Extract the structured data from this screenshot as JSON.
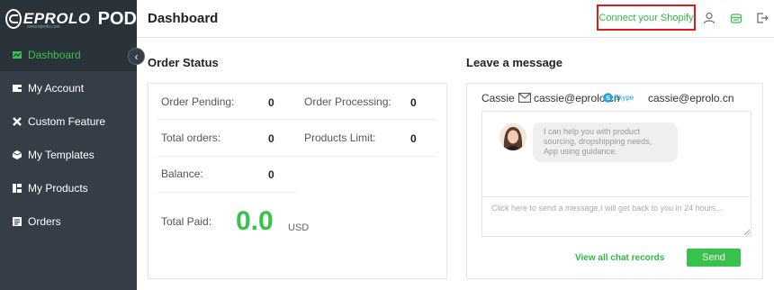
{
  "brand": {
    "name": "EPROLO",
    "product": "POD",
    "tagline": "www.eprolo.com"
  },
  "sidebar": {
    "items": [
      {
        "label": "Dashboard",
        "icon": "dashboard-icon",
        "active": true
      },
      {
        "label": "My Account",
        "icon": "wallet-icon"
      },
      {
        "label": "Custom Feature",
        "icon": "tools-icon"
      },
      {
        "label": "My Templates",
        "icon": "box-icon"
      },
      {
        "label": "My Products",
        "icon": "products-icon"
      },
      {
        "label": "Orders",
        "icon": "orders-icon"
      }
    ],
    "collapse_glyph": "‹"
  },
  "header": {
    "title": "Dashboard",
    "connect_label": "Connect your Shopify",
    "icons": [
      "user-icon",
      "store-icon",
      "logout-icon"
    ]
  },
  "order_status": {
    "heading": "Order Status",
    "pending_label": "Order Pending:",
    "pending_value": "0",
    "processing_label": "Order Processing:",
    "processing_value": "0",
    "total_label": "Total orders:",
    "total_value": "0",
    "limit_label": "Products Limit:",
    "limit_value": "0",
    "balance_label": "Balance:",
    "balance_value": "0",
    "paid_label": "Total Paid:",
    "paid_value": "0.0",
    "currency": "USD"
  },
  "message": {
    "heading": "Leave a message",
    "contact_name": "Cassie",
    "email": "cassie@eprolo.cn",
    "skype_label": "Skype",
    "skype": "cassie@eprolo.cn",
    "bubble_line1": "I can help you with product",
    "bubble_line2": "sourcing, dropshipping needs,",
    "bubble_line3": "App using guidance.",
    "placeholder": "Click here to send a message,I will get back to you in 24 hours...",
    "view_all": "View all chat records",
    "send_label": "Send"
  },
  "colors": {
    "accent": "#37c24b",
    "sidebar": "#353e46",
    "highlight": "#d81e1e"
  }
}
